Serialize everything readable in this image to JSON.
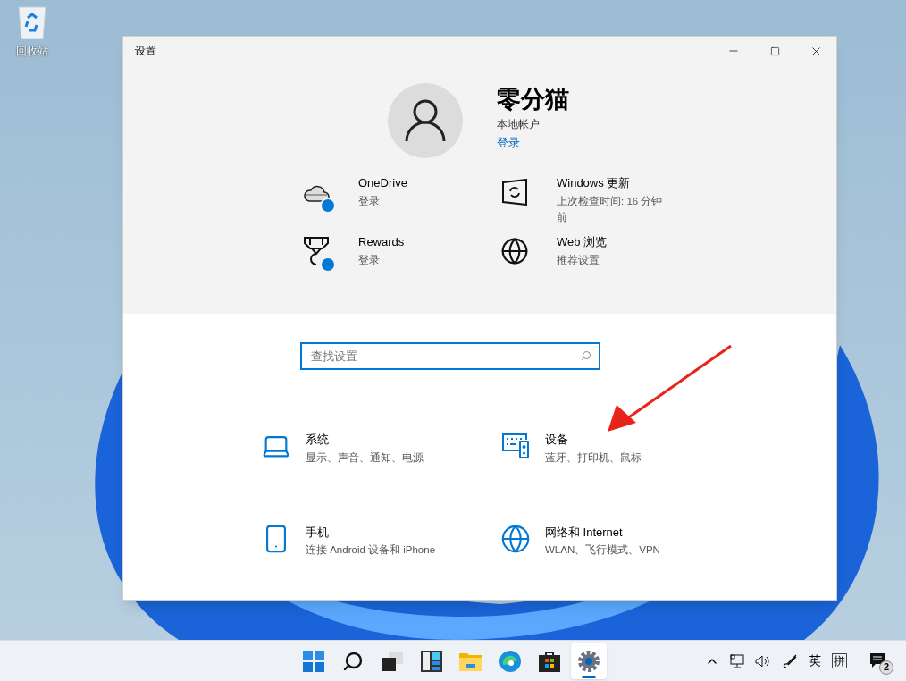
{
  "desktop_icons": [
    {
      "label": "回收站"
    }
  ],
  "window": {
    "title": "设置"
  },
  "profile": {
    "name": "零分猫",
    "account_type": "本地帐户",
    "link": "登录"
  },
  "services": [
    {
      "kind": "cloud",
      "title": "OneDrive",
      "subtitle": "登录",
      "badge": true
    },
    {
      "kind": "update",
      "title": "Windows 更新",
      "subtitle": "上次检查时间: 16 分钟前",
      "badge": false
    },
    {
      "kind": "trophy",
      "title": "Rewards",
      "subtitle": "登录",
      "badge": true
    },
    {
      "kind": "globe",
      "title": "Web 浏览",
      "subtitle": "推荐设置",
      "badge": false
    }
  ],
  "search": {
    "placeholder": "查找设置"
  },
  "categories": [
    {
      "kind": "laptop",
      "title": "系统",
      "subtitle": "显示、声音、通知、电源"
    },
    {
      "kind": "devices",
      "title": "设备",
      "subtitle": "蓝牙、打印机、鼠标"
    },
    {
      "kind": "phone",
      "title": "手机",
      "subtitle": "连接 Android 设备和 iPhone"
    },
    {
      "kind": "globe",
      "title": "网络和 Internet",
      "subtitle": "WLAN、飞行模式、VPN"
    }
  ],
  "taskbar": {
    "apps": [
      {
        "kind": "start",
        "selected": false
      },
      {
        "kind": "search",
        "selected": false
      },
      {
        "kind": "taskview",
        "selected": false
      },
      {
        "kind": "widgets",
        "selected": false
      },
      {
        "kind": "explorer",
        "selected": false
      },
      {
        "kind": "edge",
        "selected": false
      },
      {
        "kind": "store",
        "selected": false
      },
      {
        "kind": "settings",
        "selected": true
      }
    ],
    "input_mode": "英",
    "ime": "拼",
    "notification_count": "2"
  }
}
